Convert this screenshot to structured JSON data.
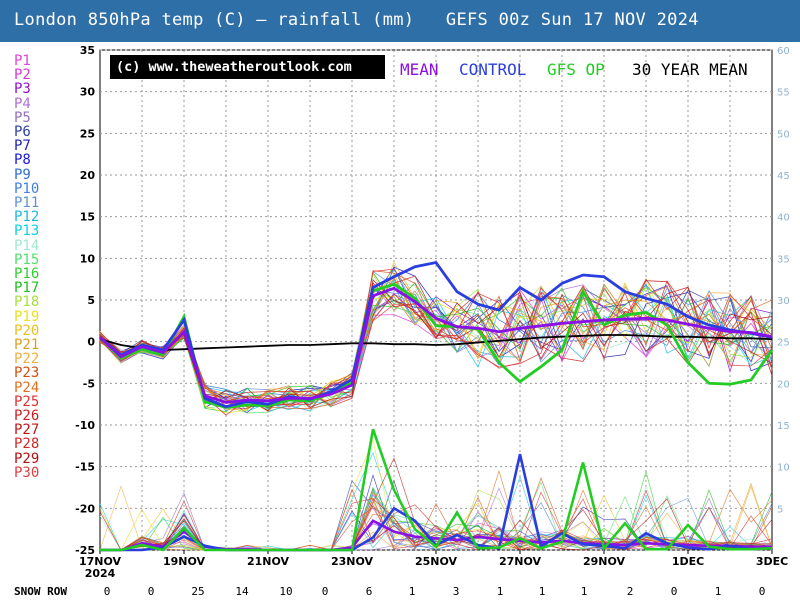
{
  "header": {
    "title": "London 850hPa temp (C) — rainfall (mm)   GEFS 00z Sun 17 NOV 2024",
    "bar_color": "#2f6fa8"
  },
  "credit": "(c) www.theweatheroutlook.com",
  "legend": [
    {
      "label": "MEAN",
      "color": "#8a10e8"
    },
    {
      "label": "CONTROL",
      "color": "#2a3ee0"
    },
    {
      "label": "GFS OP",
      "color": "#22cc22"
    },
    {
      "label": "30 YEAR MEAN",
      "color": "#000000"
    }
  ],
  "members": [
    {
      "label": "P1",
      "color": "#e040e0"
    },
    {
      "label": "P2",
      "color": "#d838d8"
    },
    {
      "label": "P3",
      "color": "#9010d0"
    },
    {
      "label": "P4",
      "color": "#b070d8"
    },
    {
      "label": "P5",
      "color": "#9070c0"
    },
    {
      "label": "P6",
      "color": "#3040a0"
    },
    {
      "label": "P7",
      "color": "#2020b0"
    },
    {
      "label": "P8",
      "color": "#1818d8"
    },
    {
      "label": "P9",
      "color": "#3070d0"
    },
    {
      "label": "P10",
      "color": "#4080e0"
    },
    {
      "label": "P11",
      "color": "#6090d8"
    },
    {
      "label": "P12",
      "color": "#20b8e0"
    },
    {
      "label": "P13",
      "color": "#10d0e8"
    },
    {
      "label": "P14",
      "color": "#a0e8d0"
    },
    {
      "label": "P15",
      "color": "#50e070"
    },
    {
      "label": "P16",
      "color": "#30d030"
    },
    {
      "label": "P17",
      "color": "#20c020"
    },
    {
      "label": "P18",
      "color": "#a8e040"
    },
    {
      "label": "P19",
      "color": "#e8e020"
    },
    {
      "label": "P20",
      "color": "#e8c020"
    },
    {
      "label": "P21",
      "color": "#e0a020"
    },
    {
      "label": "P22",
      "color": "#f0b040"
    },
    {
      "label": "P23",
      "color": "#d05010"
    },
    {
      "label": "P24",
      "color": "#e07020"
    },
    {
      "label": "P25",
      "color": "#e03030"
    },
    {
      "label": "P26",
      "color": "#d02020"
    },
    {
      "label": "P27",
      "color": "#c01818"
    },
    {
      "label": "P28",
      "color": "#d02828"
    },
    {
      "label": "P29",
      "color": "#b01010"
    },
    {
      "label": "P30",
      "color": "#e04040"
    }
  ],
  "snow_row": {
    "label": "SNOW ROW",
    "values": [
      "0",
      "0",
      "25",
      "14",
      "10",
      "0",
      "6",
      "1",
      "3",
      "1",
      "1",
      "1",
      "2",
      "0",
      "1",
      "0"
    ]
  },
  "chart_data": {
    "type": "line",
    "title": "London 850hPa temp (C) — rainfall (mm)   GEFS 00z Sun 17 NOV 2024",
    "x_range_days": [
      0,
      16
    ],
    "x_tick_labels": [
      {
        "day": 0,
        "label": "17NOV",
        "sub": "2024"
      },
      {
        "day": 2,
        "label": "19NOV"
      },
      {
        "day": 4,
        "label": "21NOV"
      },
      {
        "day": 6,
        "label": "23NOV"
      },
      {
        "day": 8,
        "label": "25NOV"
      },
      {
        "day": 10,
        "label": "27NOV"
      },
      {
        "day": 12,
        "label": "29NOV"
      },
      {
        "day": 14,
        "label": "1DEC"
      },
      {
        "day": 16,
        "label": "3DEC"
      }
    ],
    "y_left": {
      "min": -25,
      "max": 35,
      "ticks": [
        "35",
        "30",
        "25",
        "20",
        "15",
        "10",
        "5",
        "0",
        "-5",
        "-10",
        "-15",
        "-20",
        "-25"
      ]
    },
    "y_right": {
      "min": 0,
      "max": 60,
      "ticks": [
        "60",
        "55",
        "50",
        "45",
        "40",
        "35",
        "30",
        "25",
        "20",
        "15",
        "10",
        "5"
      ],
      "color": "#8fb3cc"
    },
    "grid": true,
    "temperature_series": [
      {
        "name": "MEAN",
        "color": "#8a10e8",
        "values": [
          0.5,
          -1.8,
          -0.6,
          -1.3,
          1.2,
          -6.5,
          -7.3,
          -7.0,
          -7.1,
          -6.8,
          -6.8,
          -6.3,
          -5.2,
          5.5,
          6.4,
          4.8,
          2.8,
          1.8,
          1.6,
          1.2,
          1.6,
          1.9,
          2.2,
          2.4,
          2.6,
          2.7,
          2.8,
          2.6,
          2.1,
          1.6,
          1.2,
          1.1,
          0.6
        ]
      },
      {
        "name": "CONTROL",
        "color": "#2a3ee0",
        "values": [
          0.5,
          -1.6,
          -0.4,
          -1.0,
          2.6,
          -6.8,
          -7.8,
          -7.2,
          -7.5,
          -6.6,
          -6.9,
          -6.0,
          -4.5,
          6.5,
          7.8,
          9.0,
          9.5,
          6.0,
          4.5,
          3.8,
          6.5,
          5.0,
          7.0,
          8.0,
          7.8,
          6.0,
          5.2,
          4.5,
          3.0,
          2.0,
          1.4,
          1.0,
          0.5
        ]
      },
      {
        "name": "GFS OP",
        "color": "#22cc22",
        "values": [
          0.5,
          -2.0,
          -0.9,
          -1.6,
          3.0,
          -7.2,
          -7.9,
          -7.6,
          -7.7,
          -7.0,
          -7.1,
          -6.2,
          -4.9,
          6.1,
          6.9,
          5.2,
          1.9,
          1.8,
          1.5,
          -2.5,
          -4.8,
          -3.0,
          -1.0,
          6.0,
          2.0,
          3.2,
          3.5,
          2.0,
          -2.5,
          -5.0,
          -5.1,
          -4.6,
          -1.0
        ]
      },
      {
        "name": "30 YEAR MEAN",
        "color": "#000000",
        "values": [
          0.3,
          -0.4,
          -0.8,
          -1.0,
          -0.9,
          -0.8,
          -0.7,
          -0.6,
          -0.5,
          -0.4,
          -0.4,
          -0.3,
          -0.2,
          -0.2,
          -0.3,
          -0.3,
          -0.4,
          -0.3,
          -0.1,
          0.1,
          0.3,
          0.5,
          0.6,
          0.7,
          0.8,
          0.8,
          0.7,
          0.6,
          0.6,
          0.5,
          0.4,
          0.4,
          0.3
        ]
      }
    ],
    "rainfall_series": [
      {
        "name": "MEAN",
        "color": "#8a10e8",
        "values": [
          0,
          0,
          0.8,
          0.4,
          2.2,
          0.4,
          0.1,
          0.1,
          0,
          0,
          0,
          0,
          0.3,
          3.5,
          2.2,
          1.6,
          1.4,
          1.2,
          1.6,
          1.3,
          1.1,
          0.9,
          1.1,
          0.8,
          0.7,
          0.6,
          0.8,
          0.7,
          0.6,
          0.5,
          0.5,
          0.4,
          0.4
        ]
      },
      {
        "name": "CONTROL",
        "color": "#2a3ee0",
        "values": [
          0,
          0,
          0,
          0.3,
          1.6,
          0.5,
          0,
          0,
          0,
          0,
          0,
          0,
          0,
          1.5,
          5.0,
          3.5,
          0.6,
          1.8,
          0.6,
          0.2,
          11.5,
          0.4,
          2.0,
          0.7,
          0.5,
          0.2,
          2.0,
          0.8,
          0.3,
          0.1,
          0.5,
          0.1,
          0.2
        ]
      },
      {
        "name": "GFS OP",
        "color": "#22cc22",
        "values": [
          0,
          0,
          0.6,
          0,
          2.6,
          0,
          0,
          0,
          0,
          0,
          0,
          0,
          0,
          14.5,
          7.2,
          2.5,
          0.4,
          4.5,
          0.2,
          0.3,
          1.4,
          0.2,
          1.0,
          10.5,
          0.2,
          3.2,
          0.1,
          0.1,
          3.0,
          0.4,
          0.1,
          0.1,
          0.2
        ]
      }
    ]
  }
}
